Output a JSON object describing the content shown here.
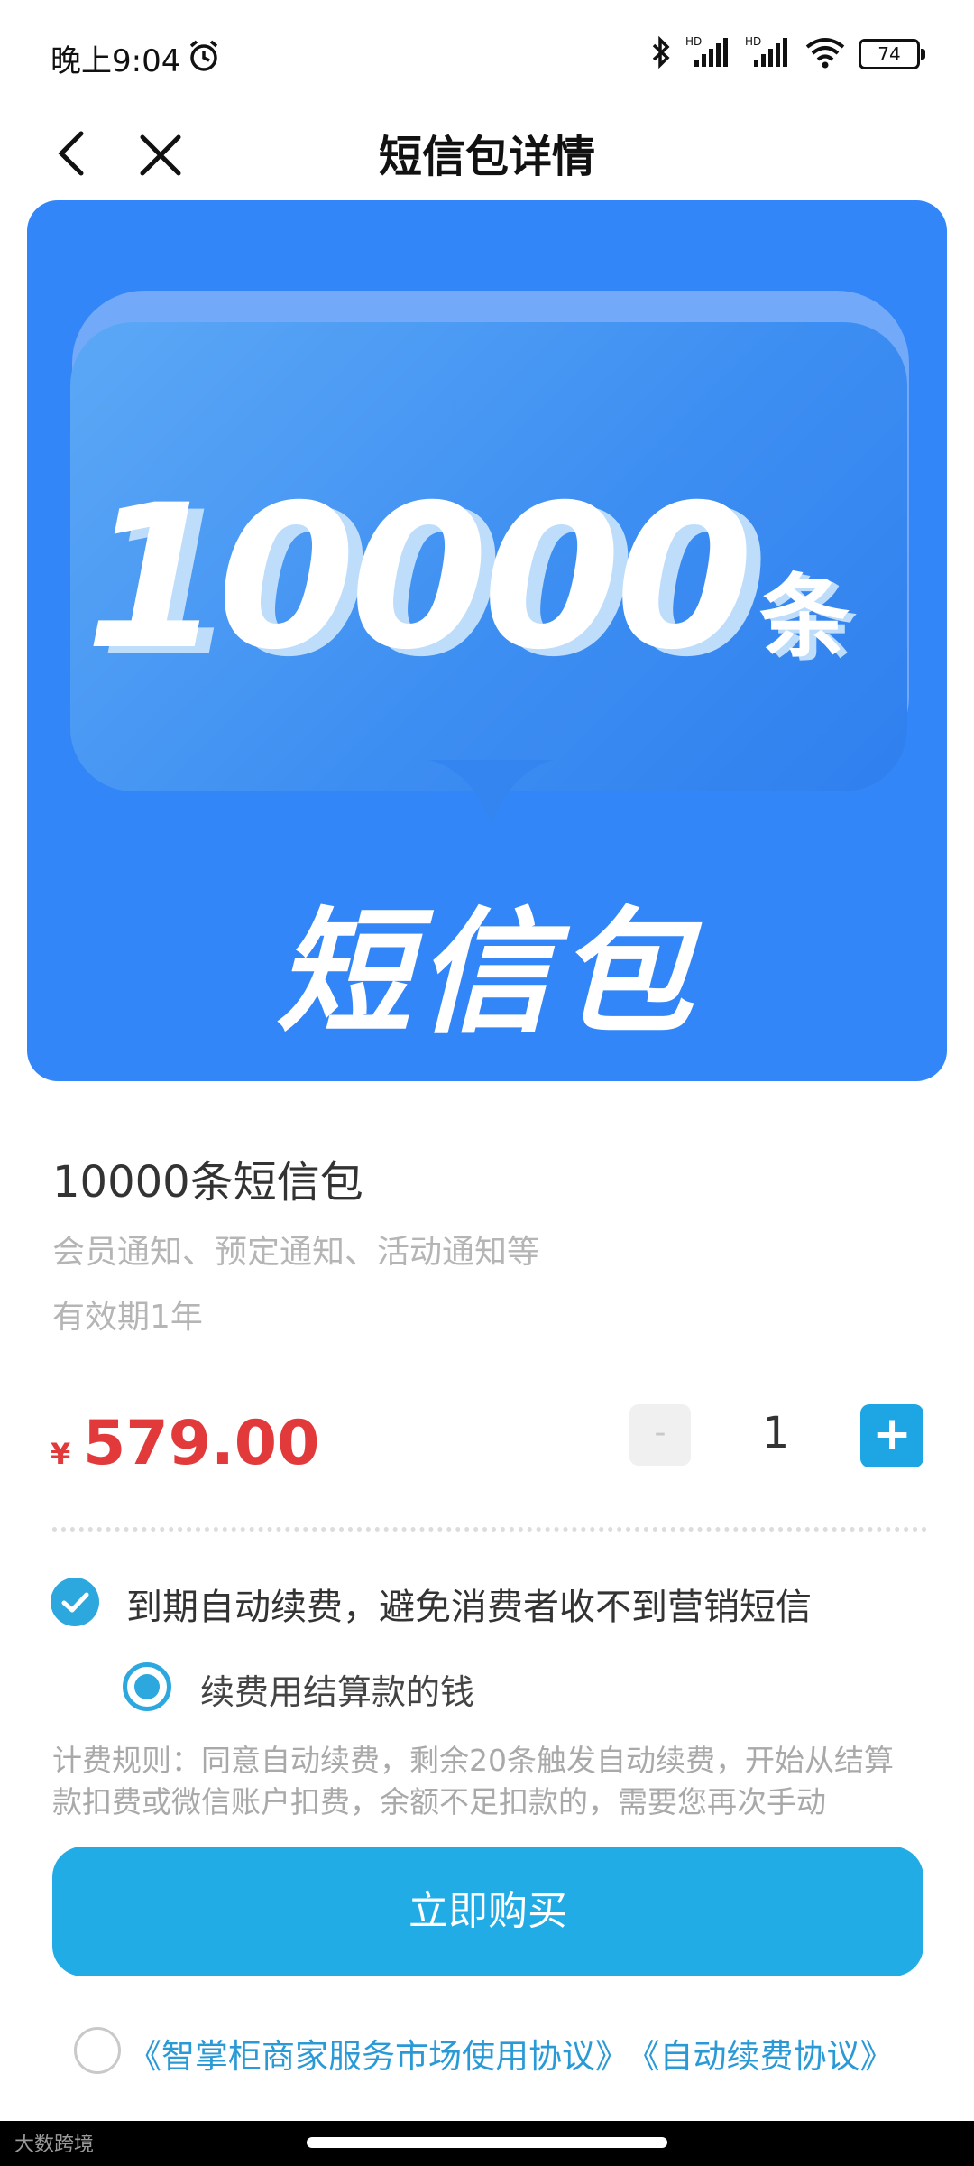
{
  "status_bar": {
    "time": "晚上9:04",
    "battery": "74"
  },
  "nav": {
    "title": "短信包详情"
  },
  "banner": {
    "number": "10000",
    "unit": "条",
    "subtitle": "短信包",
    "color": "#3386F7"
  },
  "product": {
    "title": "10000条短信包",
    "description": "会员通知、预定通知、活动通知等",
    "validity": "有效期1年",
    "currency_symbol": "¥",
    "price": "579.00",
    "price_color": "#E23A3A"
  },
  "quantity": {
    "minus_label": "-",
    "value": "1",
    "plus_label": "+"
  },
  "renew": {
    "checked": true,
    "label": "到期自动续费，避免消费者收不到营销短信",
    "option_label": "续费用结算款的钱",
    "rule_text": "计费规则：同意自动续费，剩余20条触发自动续费，开始从结算款扣费或微信账户扣费，余额不足扣款的，需要您再次手动"
  },
  "buy_button": {
    "label": "立即购买",
    "color": "#22ACE6"
  },
  "agreements": {
    "link1": "《智掌柜商家服务市场使用协议》",
    "link2": "《自动续费协议》"
  },
  "watermark": "大数跨境"
}
